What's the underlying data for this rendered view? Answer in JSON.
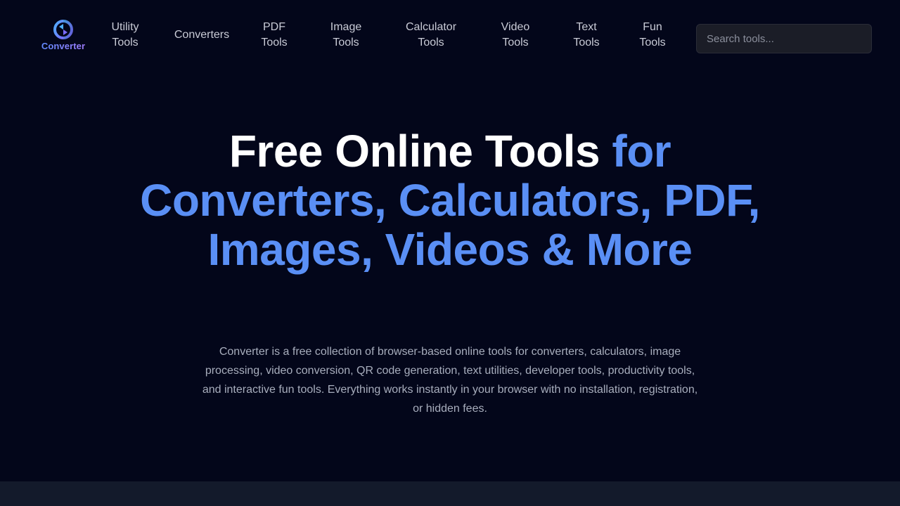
{
  "brand": {
    "name": "Converter",
    "logo_icon": "refresh-arrows-icon"
  },
  "nav": {
    "items": [
      {
        "label_line1": "Utility",
        "label_line2": "Tools"
      },
      {
        "label_line1": "Converters",
        "label_line2": ""
      },
      {
        "label_line1": "PDF",
        "label_line2": "Tools"
      },
      {
        "label_line1": "Image",
        "label_line2": "Tools"
      },
      {
        "label_line1": "Calculator",
        "label_line2": "Tools"
      },
      {
        "label_line1": "Video",
        "label_line2": "Tools"
      },
      {
        "label_line1": "Text",
        "label_line2": "Tools"
      },
      {
        "label_line1": "Fun",
        "label_line2": "Tools"
      }
    ]
  },
  "search": {
    "placeholder": "Search tools..."
  },
  "hero": {
    "title_white": "Free Online Tools",
    "title_blue": "for Converters, Calculators, PDF, Images, Videos & More",
    "description": "Converter is a free collection of browser-based online tools for converters, calculators, image processing, video conversion, QR code generation, text utilities, developer tools, productivity tools, and interactive fun tools. Everything works instantly in your browser with no installation, registration, or hidden fees."
  },
  "colors": {
    "background": "#03061a",
    "accent": "#5a8ff5",
    "text_muted": "#a8aebd"
  }
}
